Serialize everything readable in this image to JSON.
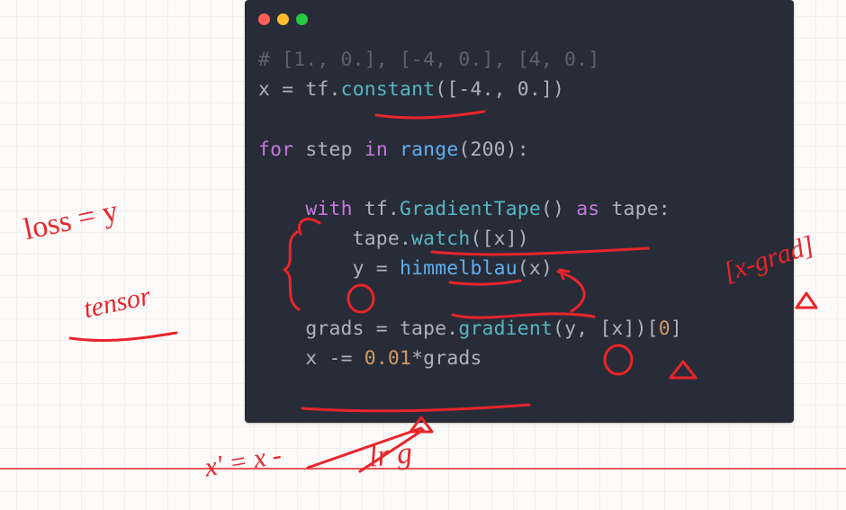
{
  "code": {
    "comment": "# [1., 0.], [-4, 0.], [4, 0.]",
    "line_assign_x_pre": "x ",
    "line_assign_x_eq": "=",
    "line_assign_x_tf": " tf",
    "line_assign_x_dot": ".",
    "line_assign_x_fn": "constant",
    "line_assign_x_args": "([-4., 0.])",
    "for_kw": "for",
    "for_mid": " step ",
    "in_kw": "in",
    "range_sp": " ",
    "range_fn": "range",
    "range_args": "(200):",
    "with_indent": "    ",
    "with_kw": "with",
    "with_sp": " tf",
    "with_dot": ".",
    "with_cls": "GradientTape",
    "with_par": "() ",
    "as_kw": "as",
    "as_tail": " tape:",
    "watch_indent": "        tape",
    "watch_dot": ".",
    "watch_fn": "watch",
    "watch_args": "([x])",
    "y_line": "        y ",
    "y_eq": "=",
    "y_sp": " ",
    "y_fn": "himmelblau",
    "y_args": "(x)",
    "grads_indent": "    grads ",
    "grads_eq": "=",
    "grads_sp": " tape",
    "grads_dot": ".",
    "grads_fn": "gradient",
    "grads_args_a": "(y, [x])[",
    "grads_zero": "0",
    "grads_args_b": "]",
    "upd_indent": "    x ",
    "upd_op": "-=",
    "upd_sp": " ",
    "upd_num": "0.01",
    "upd_star": "*",
    "upd_tail": "grads"
  },
  "handwriting": {
    "loss_eq_y": "loss = y",
    "tensor": "tensor",
    "x_minus_grad": "[x-grad]",
    "x_prime": "x' = x -",
    "lr_g": "lr g"
  }
}
